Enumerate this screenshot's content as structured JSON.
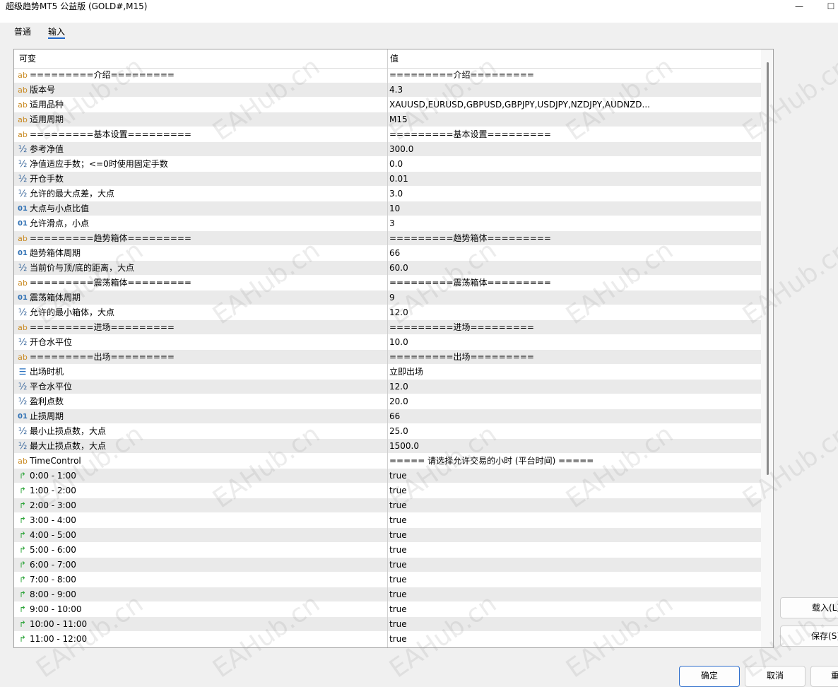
{
  "window": {
    "title": "超级趋势MT5 公益版 (GOLD#,M15)",
    "minimize": "—",
    "maximize": "☐"
  },
  "tabs": {
    "normal": "普通",
    "input": "输入"
  },
  "table": {
    "header_name": "可变",
    "header_value": "值",
    "rows": [
      {
        "icon": "ab",
        "name": "=========介绍=========",
        "value": "=========介绍========="
      },
      {
        "icon": "ab",
        "name": "版本号",
        "value": "4.3"
      },
      {
        "icon": "ab",
        "name": "适用品种",
        "value": "XAUUSD,EURUSD,GBPUSD,GBPJPY,USDJPY,NZDJPY,AUDNZD..."
      },
      {
        "icon": "ab",
        "name": "适用周期",
        "value": "M15"
      },
      {
        "icon": "ab",
        "name": "=========基本设置=========",
        "value": "=========基本设置========="
      },
      {
        "icon": "half",
        "name": "参考净值",
        "value": "300.0"
      },
      {
        "icon": "half",
        "name": "净值适应手数；<=0时使用固定手数",
        "value": "0.0"
      },
      {
        "icon": "half",
        "name": "开仓手数",
        "value": "0.01"
      },
      {
        "icon": "half",
        "name": "允许的最大点差，大点",
        "value": "3.0"
      },
      {
        "icon": "int",
        "name": "大点与小点比值",
        "value": "10"
      },
      {
        "icon": "int",
        "name": "允许滑点，小点",
        "value": "3"
      },
      {
        "icon": "ab",
        "name": "=========趋势箱体=========",
        "value": "=========趋势箱体========="
      },
      {
        "icon": "int",
        "name": "趋势箱体周期",
        "value": "66"
      },
      {
        "icon": "half",
        "name": "当前价与顶/底的距离，大点",
        "value": "60.0"
      },
      {
        "icon": "ab",
        "name": "=========震荡箱体=========",
        "value": "=========震荡箱体========="
      },
      {
        "icon": "int",
        "name": "震荡箱体周期",
        "value": "9"
      },
      {
        "icon": "half",
        "name": "允许的最小箱体，大点",
        "value": "12.0"
      },
      {
        "icon": "ab",
        "name": "=========进场=========",
        "value": "=========进场========="
      },
      {
        "icon": "half",
        "name": "开仓水平位",
        "value": "10.0"
      },
      {
        "icon": "ab",
        "name": "=========出场=========",
        "value": "=========出场========="
      },
      {
        "icon": "enum",
        "name": "出场时机",
        "value": "立即出场"
      },
      {
        "icon": "half",
        "name": "平仓水平位",
        "value": "12.0"
      },
      {
        "icon": "half",
        "name": "盈利点数",
        "value": "20.0"
      },
      {
        "icon": "int",
        "name": "止损周期",
        "value": "66"
      },
      {
        "icon": "half",
        "name": "最小止损点数，大点",
        "value": "25.0"
      },
      {
        "icon": "half",
        "name": "最大止损点数，大点",
        "value": "1500.0"
      },
      {
        "icon": "ab",
        "name": "TimeControl",
        "value": "===== 请选择允许交易的小时 (平台时间) ====="
      },
      {
        "icon": "bool",
        "name": "0:00 - 1:00",
        "value": "true"
      },
      {
        "icon": "bool",
        "name": "1:00 - 2:00",
        "value": "true"
      },
      {
        "icon": "bool",
        "name": "2:00 - 3:00",
        "value": "true"
      },
      {
        "icon": "bool",
        "name": "3:00 - 4:00",
        "value": "true"
      },
      {
        "icon": "bool",
        "name": "4:00 - 5:00",
        "value": "true"
      },
      {
        "icon": "bool",
        "name": "5:00 - 6:00",
        "value": "true"
      },
      {
        "icon": "bool",
        "name": "6:00 - 7:00",
        "value": "true"
      },
      {
        "icon": "bool",
        "name": "7:00 - 8:00",
        "value": "true"
      },
      {
        "icon": "bool",
        "name": "8:00 - 9:00",
        "value": "true"
      },
      {
        "icon": "bool",
        "name": "9:00 - 10:00",
        "value": "true"
      },
      {
        "icon": "bool",
        "name": "10:00 - 11:00",
        "value": "true"
      },
      {
        "icon": "bool",
        "name": "11:00 - 12:00",
        "value": "true"
      }
    ]
  },
  "icons": {
    "ab": "ab",
    "half": "½",
    "int": "01",
    "enum": "☰",
    "bool": "↱"
  },
  "buttons": {
    "load": "载入(L)",
    "save": "保存(S)",
    "ok": "确定",
    "cancel": "取消",
    "reset": "重"
  },
  "watermark": "EAHub.cn"
}
